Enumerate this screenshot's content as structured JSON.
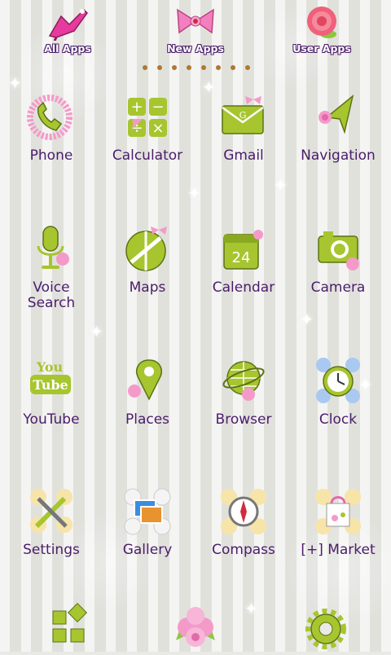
{
  "tabs": [
    {
      "label": "All Apps",
      "icon": "high-heel-shoe-icon"
    },
    {
      "label": "New Apps",
      "icon": "pink-bow-icon"
    },
    {
      "label": "User Apps",
      "icon": "rose-icon"
    }
  ],
  "page_indicator": {
    "count": 8
  },
  "apps": [
    {
      "label": "Phone",
      "icon": "phone-icon"
    },
    {
      "label": "Calculator",
      "icon": "calculator-icon"
    },
    {
      "label": "Gmail",
      "icon": "gmail-envelope-icon"
    },
    {
      "label": "Navigation",
      "icon": "navigation-arrow-icon"
    },
    {
      "label": "Voice\nSearch",
      "icon": "microphone-icon"
    },
    {
      "label": "Maps",
      "icon": "maps-icon"
    },
    {
      "label": "Calendar",
      "icon": "calendar-icon",
      "day": "24"
    },
    {
      "label": "Camera",
      "icon": "camera-icon"
    },
    {
      "label": "YouTube",
      "icon": "youtube-icon",
      "text_top": "You",
      "text_bottom": "Tube"
    },
    {
      "label": "Places",
      "icon": "place-pin-icon"
    },
    {
      "label": "Browser",
      "icon": "globe-icon"
    },
    {
      "label": "Clock",
      "icon": "clock-icon"
    },
    {
      "label": "Settings",
      "icon": "tools-icon"
    },
    {
      "label": "Gallery",
      "icon": "gallery-icon"
    },
    {
      "label": "Compass",
      "icon": "compass-icon"
    },
    {
      "label": "[+] Market",
      "icon": "shopping-bag-icon"
    }
  ],
  "dock": [
    {
      "icon": "app-drawer-grid-icon"
    },
    {
      "icon": "roses-home-icon"
    },
    {
      "icon": "gear-icon"
    }
  ],
  "colors": {
    "accent_green": "#a7c52e",
    "label_purple": "#4a1c6b",
    "pink": "#f27bbd"
  }
}
